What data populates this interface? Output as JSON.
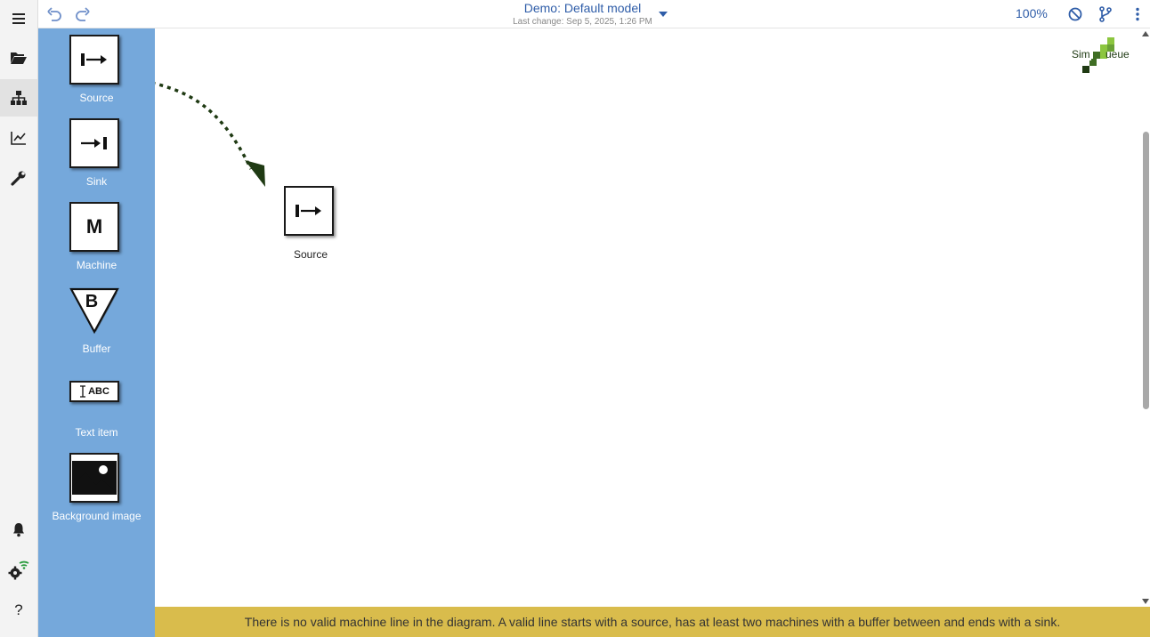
{
  "header": {
    "title": "Demo: Default model",
    "last_change": "Last change: Sep 5, 2025, 1:26 PM",
    "zoom": "100%"
  },
  "palette": {
    "items": [
      {
        "label": "Source",
        "icon": "source-icon"
      },
      {
        "label": "Sink",
        "icon": "sink-icon"
      },
      {
        "label": "Machine",
        "icon": "machine-icon"
      },
      {
        "label": "Buffer",
        "icon": "buffer-icon"
      },
      {
        "label": "Text item",
        "icon": "text-item-icon"
      },
      {
        "label": "Background image",
        "icon": "image-icon"
      }
    ],
    "machine_glyph": "M",
    "buffer_glyph": "B",
    "text_glyph": "ABC"
  },
  "canvas": {
    "nodes": [
      {
        "label": "Source",
        "type": "source"
      }
    ]
  },
  "logo": {
    "text_left": "Sim",
    "text_right": "ueue",
    "accent_colors": [
      "#8cc63f",
      "#1f3a13"
    ]
  },
  "status": {
    "message": "There is no valid machine line in the diagram. A valid line starts with a source, has at least two machines with a buffer between and ends with a sink."
  },
  "colors": {
    "palette_bg": "#75a8db",
    "status_bg": "#d9bc4c",
    "accent": "#2f5da8"
  }
}
